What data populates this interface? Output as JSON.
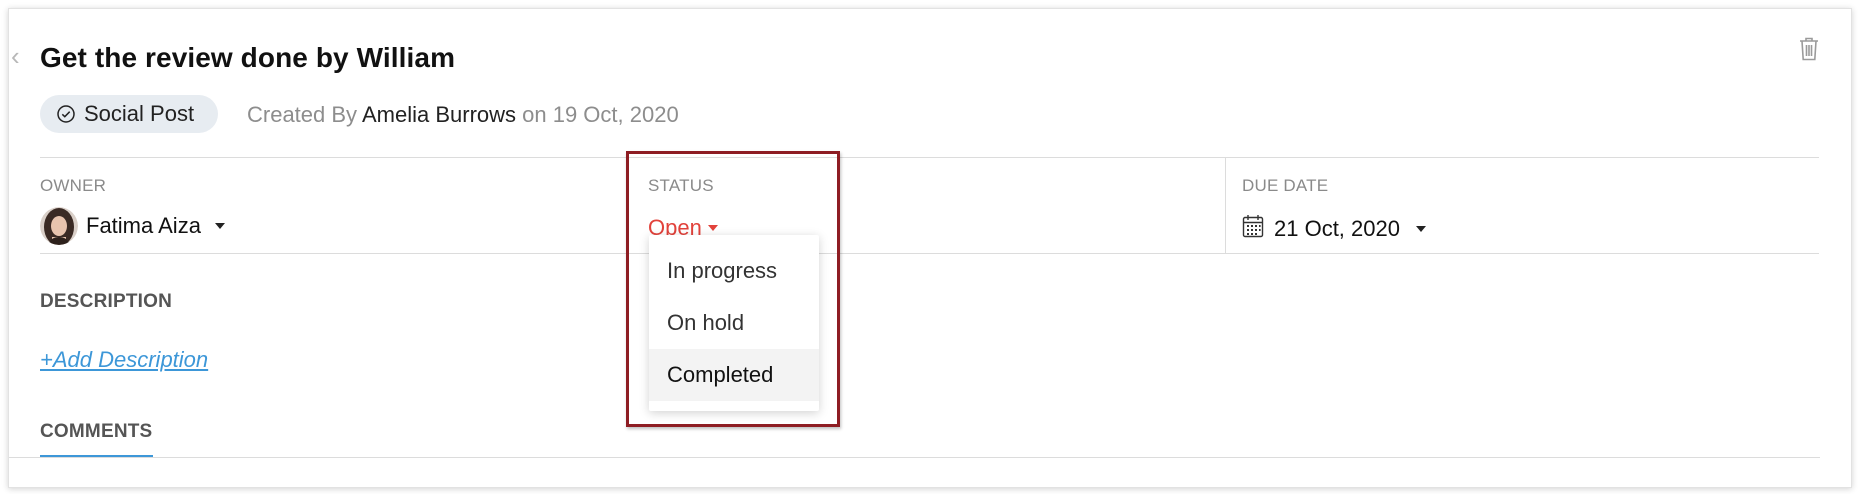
{
  "task": {
    "title": "Get the review done by William",
    "type_chip": "Social Post",
    "created_prefix": "Created By",
    "created_by": "Amelia Burrows",
    "created_on": "on 19 Oct, 2020"
  },
  "fields": {
    "owner_label": "OWNER",
    "owner_name": "Fatima Aiza",
    "status_label": "STATUS",
    "status_value": "Open",
    "due_label": "DUE DATE",
    "due_value": "21 Oct, 2020"
  },
  "status_dropdown": {
    "options": [
      "In progress",
      "On hold",
      "Completed"
    ],
    "hovered": "Completed"
  },
  "description": {
    "label": "DESCRIPTION",
    "add_link": "+Add Description"
  },
  "comments": {
    "label": "COMMENTS"
  },
  "colors": {
    "status_open": "#e2423b",
    "link": "#3d97d8",
    "highlight_border": "#8e1d23",
    "chip_bg": "#e7ecf1"
  },
  "icons": [
    "back-arrow-icon",
    "trash-icon",
    "check-circle-icon",
    "caret-down-icon",
    "calendar-icon"
  ]
}
